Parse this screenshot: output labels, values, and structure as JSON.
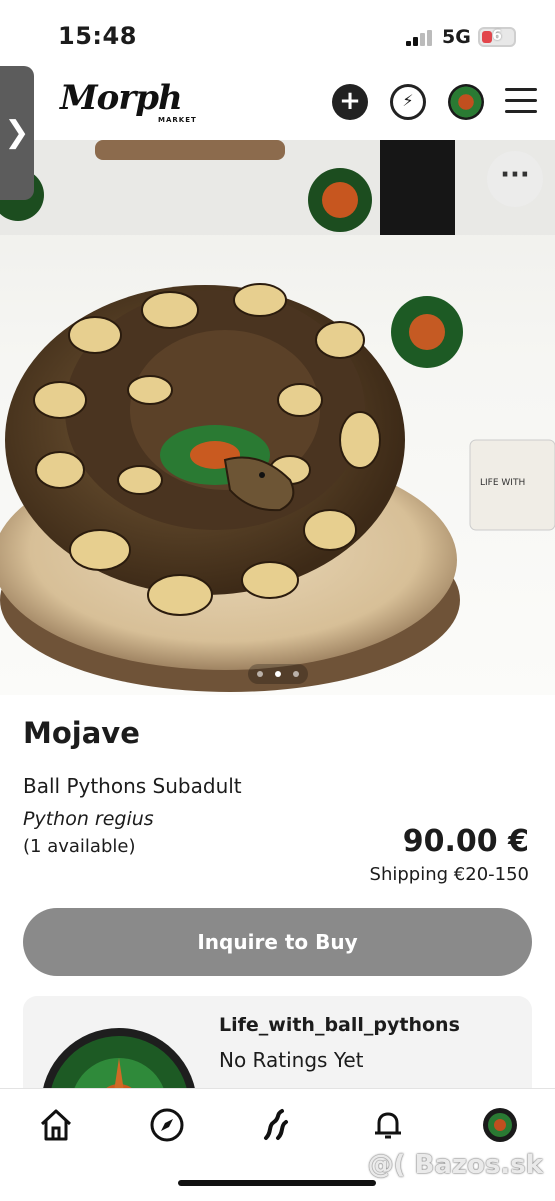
{
  "status_bar": {
    "time": "15:48",
    "network": "5G",
    "battery": "6"
  },
  "header": {
    "logo": "Morph",
    "logo_sub": "MARKET",
    "icons": [
      "chevron-left-icon",
      "add-icon",
      "chat-bolt-icon",
      "avatar-icon",
      "hamburger-menu-icon"
    ]
  },
  "gallery": {
    "image_count": 3,
    "active_index": 1
  },
  "listing": {
    "title": "Mojave",
    "category": "Ball Pythons Subadult",
    "species": "Python regius",
    "availability": "(1 available)",
    "price": "90.00 €",
    "shipping": "Shipping €20-150",
    "cta": "Inquire to Buy"
  },
  "seller": {
    "name": "Life_with_ball_pythons",
    "rating": "No Ratings Yet"
  },
  "nav": {
    "items": [
      "home-icon",
      "explore-compass-icon",
      "snake-icon",
      "notifications-bell-icon",
      "profile-avatar-icon"
    ]
  },
  "watermark": "@( Bazos.sk",
  "colors": {
    "cta_bg": "#8a8a8a",
    "card_bg": "#f3f3f3",
    "text": "#1c1c1c",
    "battery_low": "#e2454b"
  }
}
